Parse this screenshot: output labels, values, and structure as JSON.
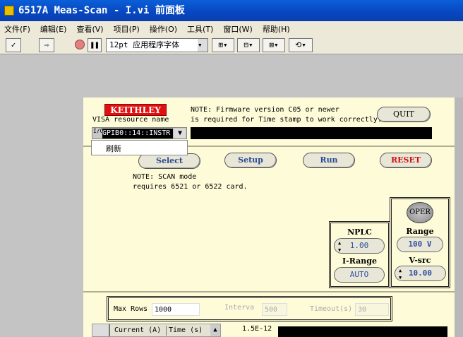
{
  "window": {
    "title": "6517A Meas-Scan - I.vi 前面板"
  },
  "menu": [
    "文件(F)",
    "编辑(E)",
    "查看(V)",
    "项目(P)",
    "操作(O)",
    "工具(T)",
    "窗口(W)",
    "帮助(H)"
  ],
  "toolbar": {
    "run": "✓",
    "run_continuous": "⇨",
    "font": "12pt 应用程序字体"
  },
  "panel": {
    "logo": "KEITHLEY",
    "visa_label": "VISA resource name",
    "visa_value": "GPIB0::14::INSTR",
    "visa_menu_item": "刷新",
    "note_firmware_1": "NOTE: Firmware version C05 or newer",
    "note_firmware_2": "is required for Time stamp to work correctly.",
    "quit": "QUIT",
    "select": "Select",
    "setup": "Setup",
    "run": "Run",
    "reset": "RESET",
    "note_scan_1": "NOTE: SCAN mode",
    "note_scan_2": "requires 6521 or 6522 card.",
    "nplc_label": "NPLC",
    "nplc_value": "1.00",
    "irange_label": "I-Range",
    "irange_value": "AUTO",
    "oper": "OPER",
    "range_label": "Range",
    "range_value": "100 V",
    "vsrc_label": "V-src",
    "vsrc_value": "10.00",
    "maxrows_label": "Max Rows",
    "maxrows_value": "1000",
    "interval_label": "Interva",
    "interval_value": "500",
    "timeout_label": "Timeout(s)",
    "timeout_value": "30",
    "table_headers": [
      "Current (A)",
      "Time (s)"
    ],
    "graph_ymax": "1.5E-12"
  }
}
